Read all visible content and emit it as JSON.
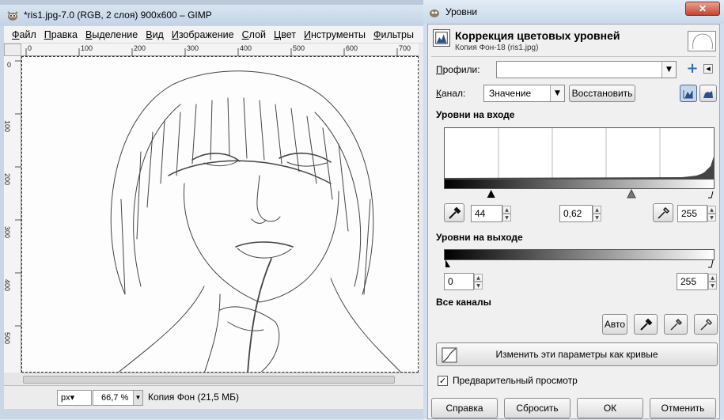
{
  "gimp": {
    "title": "*ris1.jpg-7.0 (RGB, 2 слоя) 900x600 – GIMP",
    "menu": [
      {
        "label": "Файл",
        "ak": "Ф",
        "rest": "айл"
      },
      {
        "label": "Правка",
        "ak": "П",
        "rest": "равка"
      },
      {
        "label": "Выделение",
        "ak": "В",
        "rest": "ыделение"
      },
      {
        "label": "Вид",
        "ak": "В",
        "rest": "ид"
      },
      {
        "label": "Изображение",
        "ak": "И",
        "rest": "зображение"
      },
      {
        "label": "Слой",
        "ak": "С",
        "rest": "лой"
      },
      {
        "label": "Цвет",
        "ak": "Ц",
        "rest": "вет"
      },
      {
        "label": "Инструменты",
        "ak": "И",
        "rest": "нструменты"
      },
      {
        "label": "Фильтры",
        "ak": "Ф",
        "rest": "ильтры"
      }
    ],
    "hruler_ticks": [
      "0",
      "100",
      "200",
      "300",
      "400",
      "500",
      "600",
      "700"
    ],
    "vruler_ticks": [
      "0",
      "100",
      "200",
      "300",
      "400",
      "500"
    ],
    "status": {
      "unit": "px",
      "zoom": "66,7 %",
      "layer_info": "Копия Фон (21,5 МБ)"
    }
  },
  "levels": {
    "window_title": "Уровни",
    "close_label": "✕",
    "header_title": "Коррекция цветовых уровней",
    "header_subtitle": "Копия Фон-18 (ris1.jpg)",
    "profiles_label": "Профили:",
    "profiles_value": "",
    "channel_label": "Канал:",
    "channel_value": "Значение",
    "reset_channel_label": "Восстановить",
    "input_levels_label": "Уровни на входе",
    "input_low": "44",
    "input_gamma": "0,62",
    "input_high": "255",
    "input_low_level": 44,
    "input_mid_level": 177,
    "output_levels_label": "Уровни на выходе",
    "output_low": "0",
    "output_high": "255",
    "all_channels_label": "Все каналы",
    "auto_label": "Авто",
    "edit_curves_label": "Изменить эти параметры как кривые",
    "preview_label": "Предварительный просмотр",
    "preview_checked": true,
    "buttons": {
      "help": "Справка",
      "reset": "Сбросить",
      "ok": "ОК",
      "cancel": "Отменить"
    }
  }
}
